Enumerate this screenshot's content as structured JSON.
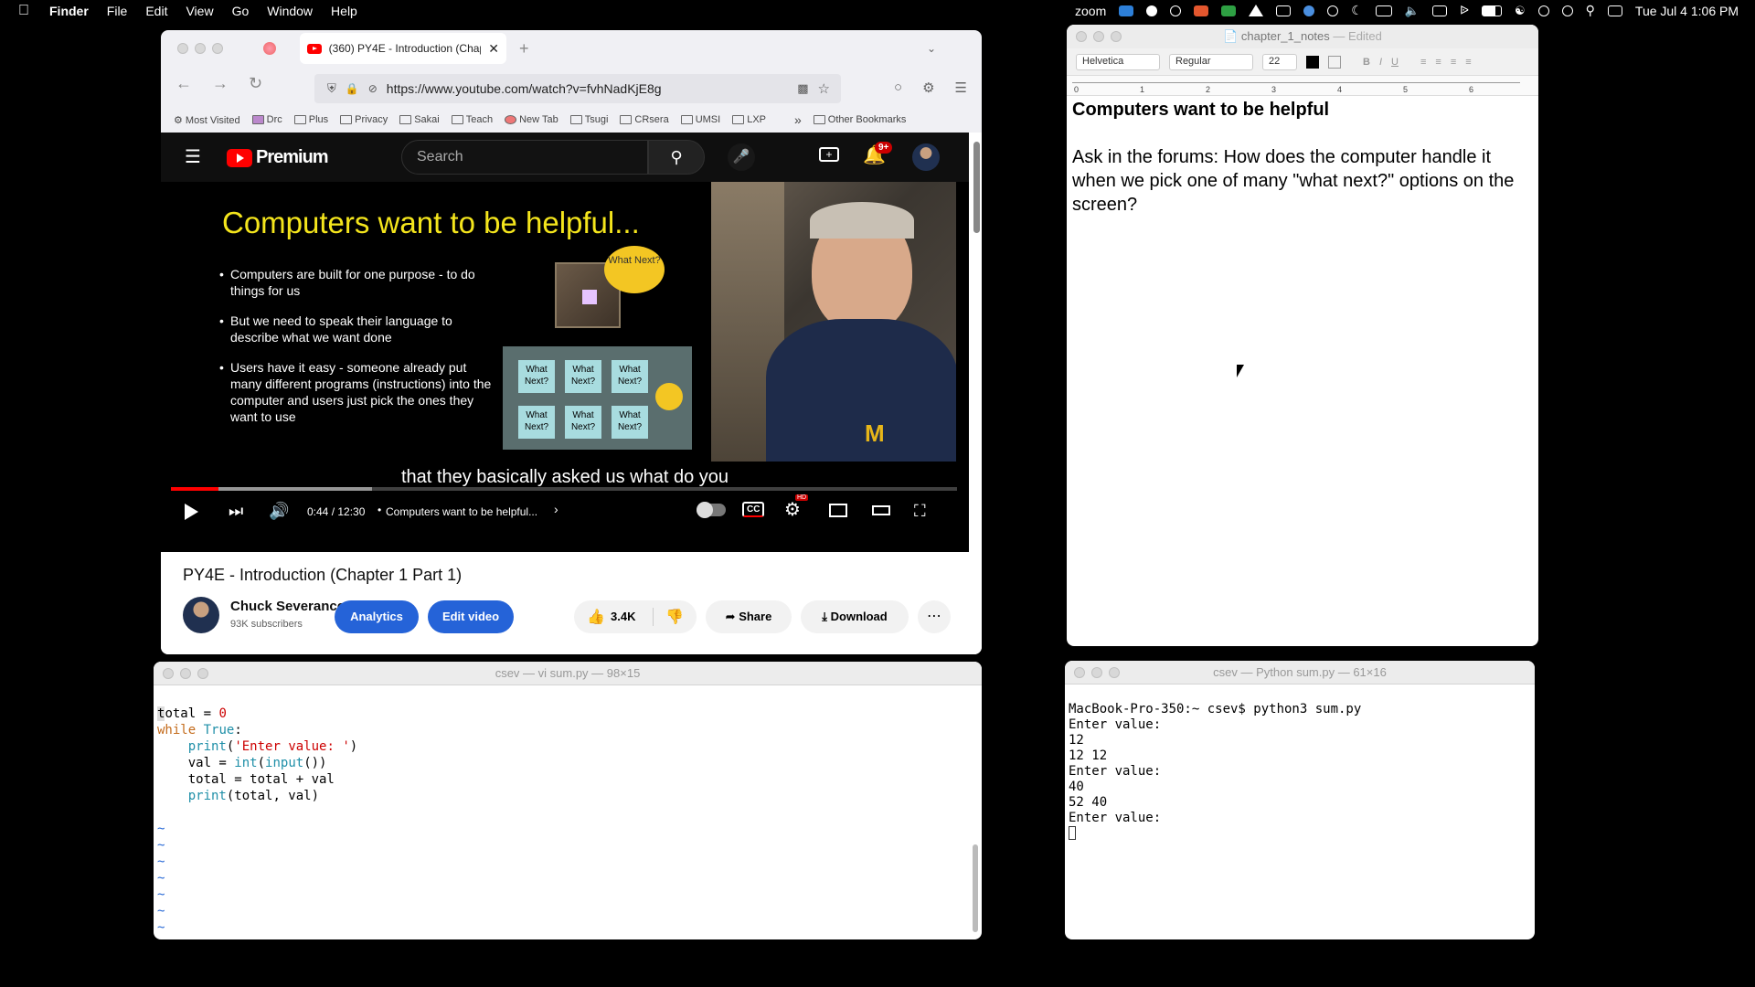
{
  "menubar": {
    "app": "Finder",
    "items": [
      "File",
      "Edit",
      "View",
      "Go",
      "Window",
      "Help"
    ],
    "status_zoom": "zoom",
    "datetime": "Tue Jul 4  1:06 PM"
  },
  "browser": {
    "tab_title": "(360) PY4E - Introduction (Chap",
    "url": "https://www.youtube.com/watch?v=fvhNadKjE8g",
    "bookmarks": [
      "Most Visited",
      "Drc",
      "Plus",
      "Privacy",
      "Sakai",
      "Teach",
      "New Tab",
      "Tsugi",
      "CRsera",
      "UMSI",
      "LXP"
    ],
    "other_bookmarks": "Other Bookmarks"
  },
  "youtube": {
    "logo": "Premium",
    "search_placeholder": "Search",
    "notif_badge": "9+",
    "slide": {
      "title": "Computers want to be helpful...",
      "bullets": [
        "Computers are built for one purpose - to do things for us",
        "But we need to speak their language to describe what we want done",
        "Users have it easy - someone already put many different programs (instructions) into the computer and users just pick the ones they want to use"
      ],
      "bubble": "What Next?",
      "grid_label": "What Next?"
    },
    "caption": "that they basically asked us what do you",
    "time": "0:44 / 12:30",
    "chapter": "Computers want to be helpful...",
    "progress": 0.06,
    "video_title": "PY4E - Introduction (Chapter 1 Part 1)",
    "channel": "Chuck Severance",
    "subscribers": "93K subscribers",
    "analytics": "Analytics",
    "edit_video": "Edit video",
    "likes": "3.4K",
    "share": "Share",
    "download": "Download",
    "cc": "CC",
    "hd": "HD"
  },
  "notes": {
    "title": "chapter_1_notes",
    "edited": "— Edited",
    "font": "Helvetica",
    "style": "Regular",
    "size": "22",
    "heading": "Computers want to be helpful",
    "body": "Ask in the forums:  How does the computer handle it when we pick one of many \"what next?\" options on the screen?",
    "ruler_numbers": [
      "0",
      "1",
      "2",
      "3",
      "4",
      "5",
      "6"
    ]
  },
  "vi": {
    "title": "csev — vi sum.py — 98×15"
  },
  "terminal": {
    "title": "csev — Python sum.py — 61×16",
    "lines": [
      "MacBook-Pro-350:~ csev$ python3 sum.py",
      "Enter value:",
      "12",
      "12 12",
      "Enter value:",
      "40",
      "52 40",
      "Enter value:"
    ]
  }
}
